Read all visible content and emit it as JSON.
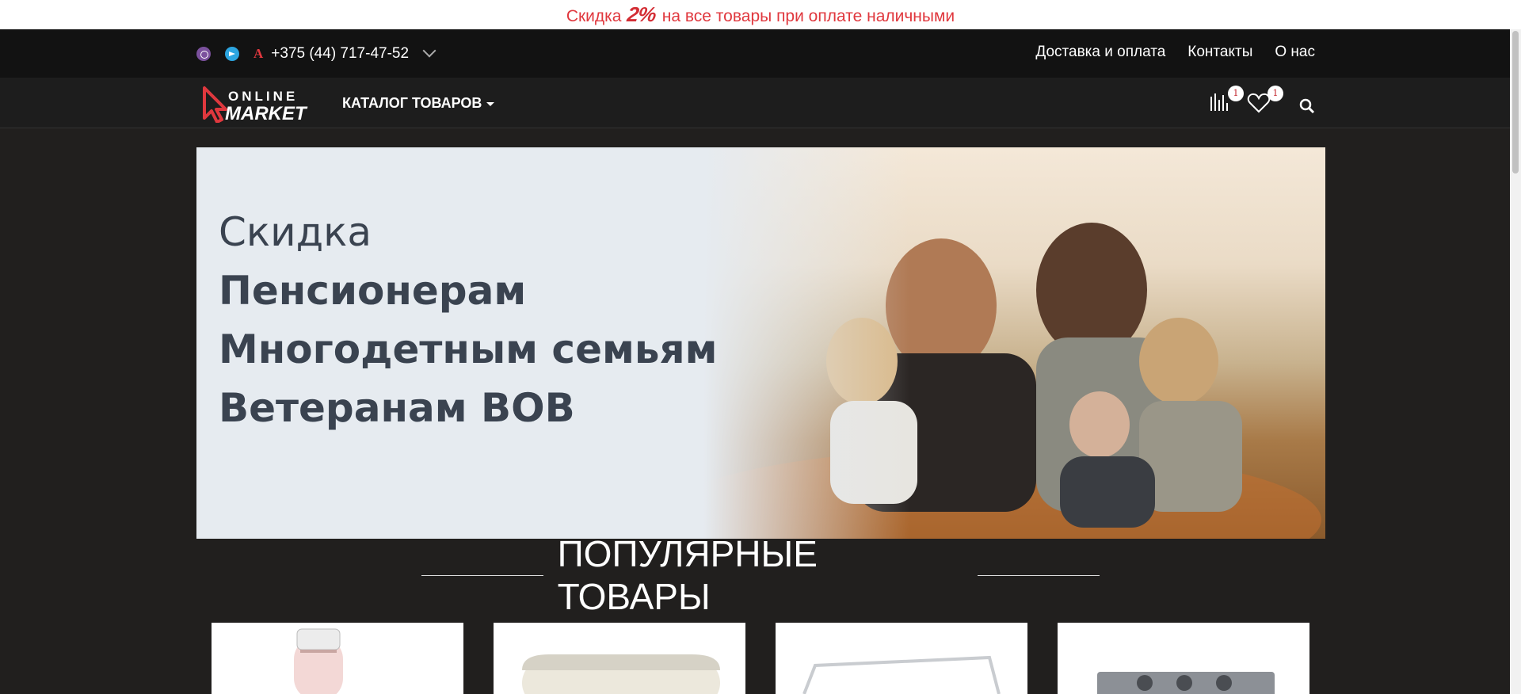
{
  "promo": {
    "prefix": "Скидка",
    "percent": "2%",
    "suffix": "на все товары при оплате наличными"
  },
  "topbar": {
    "phone": "+375 (44) 717-47-52",
    "operator": "A",
    "links": [
      "Доставка и оплата",
      "Контакты",
      "О нас"
    ]
  },
  "header": {
    "logo_top": "ONLINE",
    "logo_bottom": "MARKET",
    "catalog_label": "КАТАЛОГ ТОВАРОВ",
    "compare_count": "1",
    "wishlist_count": "1"
  },
  "banner": {
    "line1": "Скидка",
    "line2": "Пенсионерам",
    "line3": "Многодетным семьям",
    "line4": "Ветеранам ВОВ"
  },
  "section": {
    "title": "ПОПУЛЯРНЫЕ ТОВАРЫ"
  },
  "products": [
    {
      "icon": "epilator-icon"
    },
    {
      "icon": "toaster-icon"
    },
    {
      "icon": "frame-icon"
    },
    {
      "icon": "gas-stove-icon"
    }
  ],
  "colors": {
    "accent": "#e0383e",
    "dark": "#211f1e",
    "topbar": "#121212"
  }
}
